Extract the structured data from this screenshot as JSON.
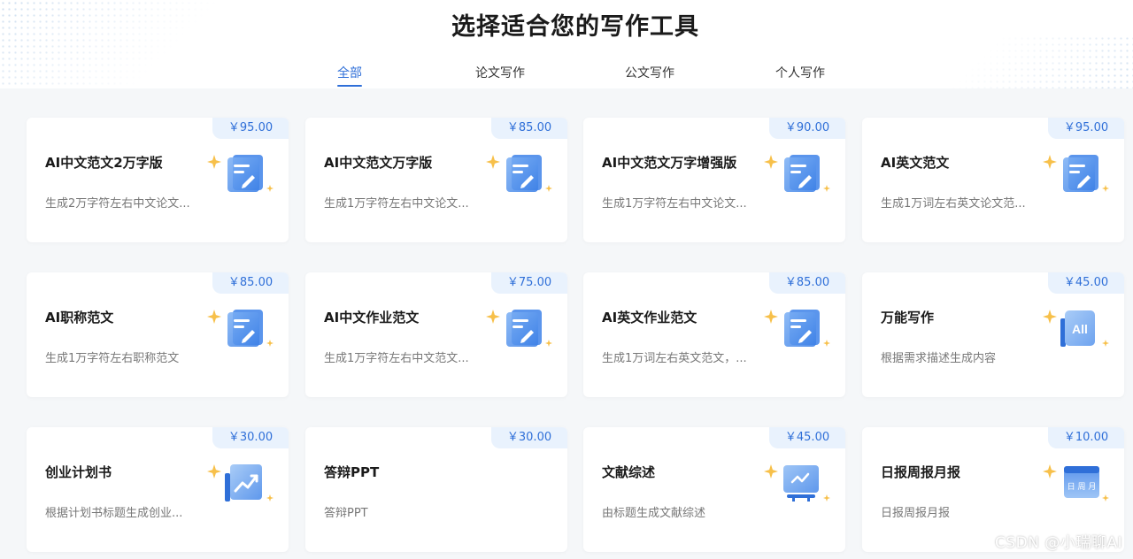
{
  "header": {
    "title": "选择适合您的写作工具",
    "tabs": [
      {
        "label": "全部",
        "active": true
      },
      {
        "label": "论文写作",
        "active": false
      },
      {
        "label": "公文写作",
        "active": false
      },
      {
        "label": "个人写作",
        "active": false
      }
    ]
  },
  "accent_color": "#2f6fd8",
  "cards": [
    {
      "price": "￥95.00",
      "title": "AI中文范文2万字版",
      "desc": "生成2万字符左右中文论文...",
      "icon": "document-edit-icon"
    },
    {
      "price": "￥85.00",
      "title": "AI中文范文万字版",
      "desc": "生成1万字符左右中文论文...",
      "icon": "document-edit-icon"
    },
    {
      "price": "￥90.00",
      "title": "AI中文范文万字增强版",
      "desc": "生成1万字符左右中文论文...",
      "icon": "document-edit-icon"
    },
    {
      "price": "￥95.00",
      "title": "AI英文范文",
      "desc": "生成1万词左右英文论文范...",
      "icon": "document-edit-icon"
    },
    {
      "price": "￥85.00",
      "title": "AI职称范文",
      "desc": "生成1万字符左右职称范文",
      "icon": "document-edit-icon"
    },
    {
      "price": "￥75.00",
      "title": "AI中文作业范文",
      "desc": "生成1万字符左右中文范文...",
      "icon": "document-edit-icon"
    },
    {
      "price": "￥85.00",
      "title": "AI英文作业范文",
      "desc": "生成1万词左右英文范文，...",
      "icon": "document-edit-icon"
    },
    {
      "price": "￥45.00",
      "title": "万能写作",
      "desc": "根据需求描述生成内容",
      "icon": "ai-book-icon",
      "icon_text": "All"
    },
    {
      "price": "￥30.00",
      "title": "创业计划书",
      "desc": "根据计划书标题生成创业...",
      "icon": "trend-chart-icon"
    },
    {
      "price": "￥30.00",
      "title": "答辩PPT",
      "desc": "答辩PPT",
      "icon": ""
    },
    {
      "price": "￥45.00",
      "title": "文献综述",
      "desc": "由标题生成文献综述",
      "icon": "presentation-board-icon"
    },
    {
      "price": "￥10.00",
      "title": "日报周报月报",
      "desc": "日报周报月报",
      "icon": "calendar-report-icon",
      "icon_text": "日 周 月"
    }
  ],
  "watermark": "CSDN @小瑞聊AI"
}
